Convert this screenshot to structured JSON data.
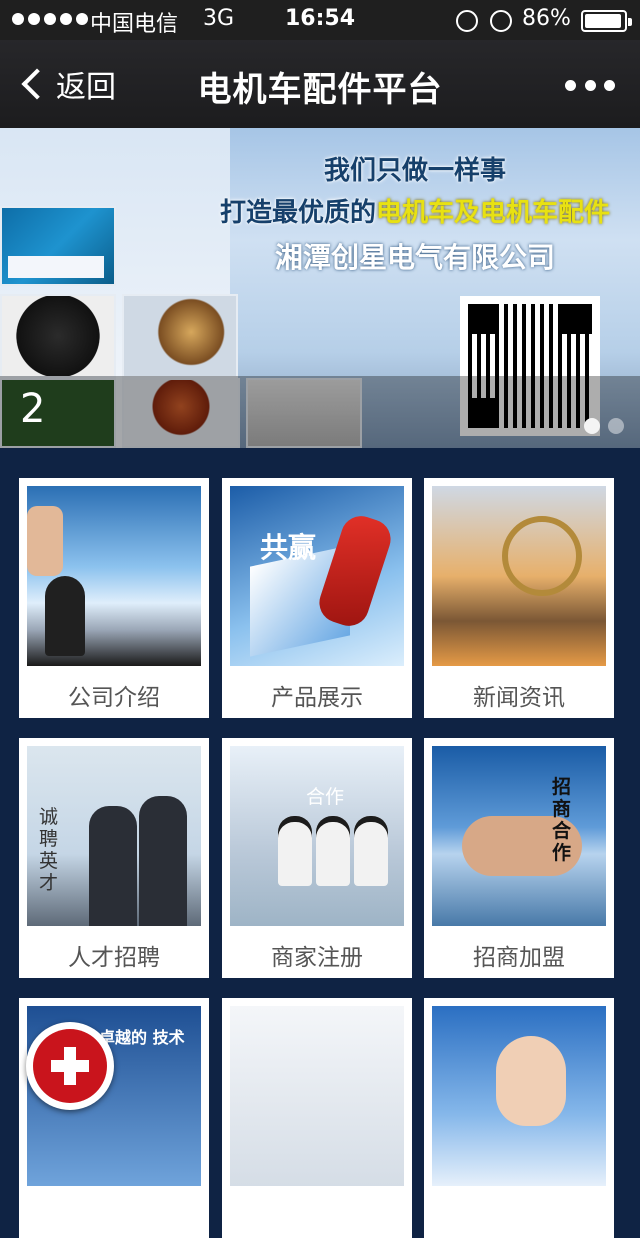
{
  "status_bar": {
    "carrier": "中国电信",
    "network": "3G",
    "time": "16:54",
    "battery": "86%",
    "battery_level": 0.86,
    "icons": [
      "signal-dots-icon",
      "rotation-lock-icon",
      "alarm-icon",
      "battery-icon"
    ]
  },
  "nav": {
    "back_label": "返回",
    "title": "电机车配件平台",
    "more_icon": "more-dots-icon"
  },
  "banner": {
    "slogan_line1": "我们只做一样事",
    "slogan_line2_prefix": "打造最优质的",
    "slogan_line2_highlight": "电机车及电机车配件",
    "slogan_line3": "湘潭创星电气有限公司",
    "slide_number": "2",
    "pager": {
      "total": 2,
      "active": 1
    },
    "highlight_color": "#e8e112"
  },
  "tiles": [
    {
      "label": "公司介绍"
    },
    {
      "label": "产品展示",
      "image_text": "共赢"
    },
    {
      "label": "新闻资讯"
    },
    {
      "label": "人才招聘",
      "image_text": "诚聘英才"
    },
    {
      "label": "商家注册",
      "image_text": "合作"
    },
    {
      "label": "招商加盟",
      "image_text": "招商合作"
    },
    {
      "label": "",
      "image_text": "卓越的 技术"
    },
    {
      "label": ""
    },
    {
      "label": ""
    }
  ],
  "floating_button": {
    "icon": "plus-icon",
    "color": "#c9141c"
  }
}
